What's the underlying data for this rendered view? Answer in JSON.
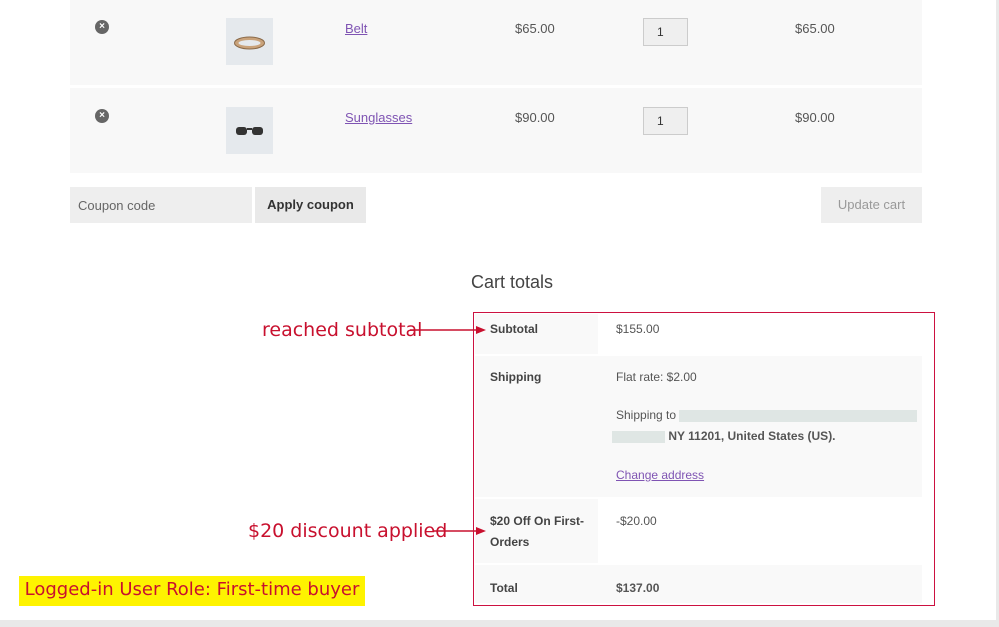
{
  "cart": {
    "items": [
      {
        "remove_icon": "×",
        "thumb_icon": "belt-icon",
        "name": "Belt",
        "price": "$65.00",
        "quantity": "1",
        "subtotal": "$65.00"
      },
      {
        "remove_icon": "×",
        "thumb_icon": "sunglasses-icon",
        "name": "Sunglasses",
        "price": "$90.00",
        "quantity": "1",
        "subtotal": "$90.00"
      }
    ],
    "coupon": {
      "placeholder": "Coupon code",
      "apply_label": "Apply coupon"
    },
    "update_label": "Update cart"
  },
  "totals": {
    "title": "Cart totals",
    "subtotal_label": "Subtotal",
    "subtotal_value": "$155.00",
    "shipping_label": "Shipping",
    "shipping_rate": "Flat rate: $2.00",
    "shipping_to_label": "Shipping to",
    "shipping_address_visible": "NY 11201, United States (US).",
    "change_address_label": "Change address",
    "discount_label": "$20 Off On First-Orders",
    "discount_value": "-$20.00",
    "total_label": "Total",
    "total_value": "$137.00"
  },
  "annotations": {
    "subtotal_note": "reached subtotal",
    "discount_note": "$20 discount applied",
    "role_note": "Logged-in User Role: First-time buyer"
  },
  "colors": {
    "accent_link": "#7f54b3",
    "annotation_red": "#c8102e",
    "highlight_yellow": "#fef300"
  }
}
